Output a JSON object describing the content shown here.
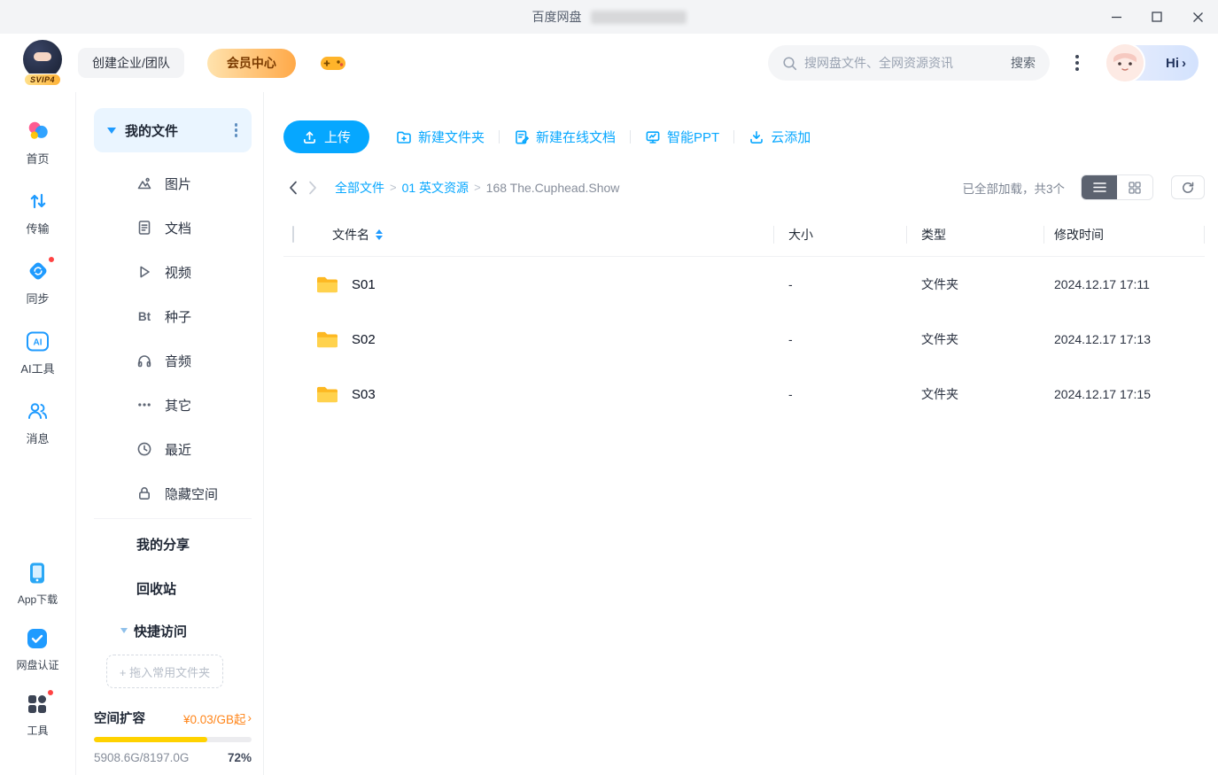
{
  "window": {
    "title": "百度网盘"
  },
  "header": {
    "logo_badge": "SVIP4",
    "create_team_label": "创建企业/团队",
    "member_center_label": "会员中心",
    "search": {
      "placeholder": "搜网盘文件、全网资源资讯",
      "button_label": "搜索"
    },
    "greeting": "Hi",
    "greeting_arrow": "›"
  },
  "nav": {
    "items": [
      {
        "label": "首页"
      },
      {
        "label": "传输"
      },
      {
        "label": "同步"
      },
      {
        "label": "AI工具"
      },
      {
        "label": "消息"
      }
    ],
    "bottom": [
      {
        "label": "App下载"
      },
      {
        "label": "网盘认证"
      },
      {
        "label": "工具"
      }
    ]
  },
  "sidebar": {
    "my_files_label": "我的文件",
    "categories": [
      {
        "label": "图片"
      },
      {
        "label": "文档"
      },
      {
        "label": "视频"
      },
      {
        "label": "种子",
        "icon_text": "Bt"
      },
      {
        "label": "音频"
      },
      {
        "label": "其它"
      },
      {
        "label": "最近"
      },
      {
        "label": "隐藏空间"
      }
    ],
    "my_share_label": "我的分享",
    "recycle_label": "回收站",
    "quick_access_label": "快捷访问",
    "drop_hint": "+ 拖入常用文件夹",
    "storage": {
      "expand_label": "空间扩容",
      "price_label": "¥0.03/GB起",
      "price_arrow": "›",
      "used_total": "5908.6G/8197.0G",
      "percent_label": "72%",
      "percent": 72
    }
  },
  "toolbar": {
    "upload_label": "上传",
    "actions": [
      {
        "label": "新建文件夹"
      },
      {
        "label": "新建在线文档"
      },
      {
        "label": "智能PPT"
      },
      {
        "label": "云添加"
      }
    ]
  },
  "breadcrumb": {
    "separator": ">",
    "links": [
      {
        "label": "全部文件"
      },
      {
        "label": "01 英文资源"
      }
    ],
    "current": "168 The.Cuphead.Show",
    "status": "已全部加载，共3个"
  },
  "file_table": {
    "headers": {
      "name": "文件名",
      "size": "大小",
      "type": "类型",
      "modified": "修改时间"
    },
    "rows": [
      {
        "name": "S01",
        "size": "-",
        "type": "文件夹",
        "modified": "2024.12.17 17:11"
      },
      {
        "name": "S02",
        "size": "-",
        "type": "文件夹",
        "modified": "2024.12.17 17:13"
      },
      {
        "name": "S03",
        "size": "-",
        "type": "文件夹",
        "modified": "2024.12.17 17:15"
      }
    ]
  },
  "colors": {
    "brand_blue": "#06a7ff",
    "storage_bar_yellow": "#ffd200",
    "price_orange": "#ff8519"
  }
}
